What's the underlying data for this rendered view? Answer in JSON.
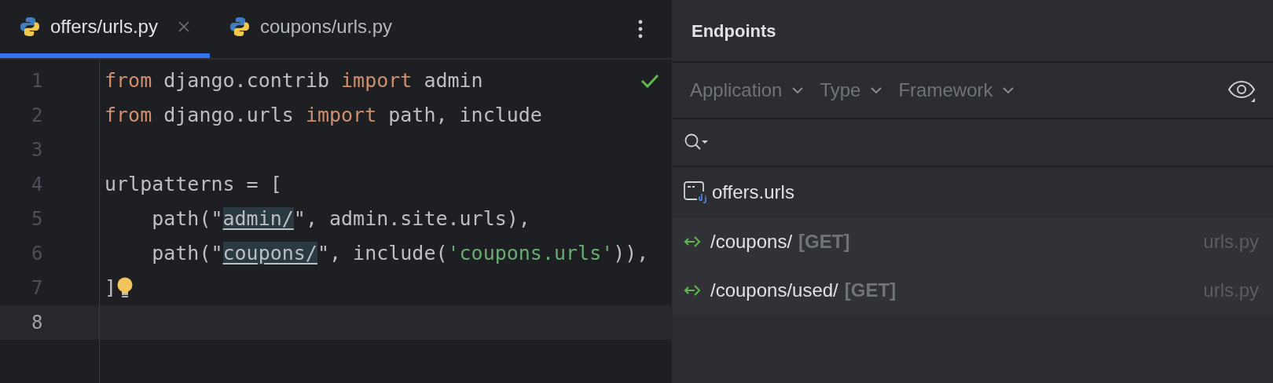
{
  "tabs": [
    {
      "label": "offers/urls.py",
      "selected": true
    },
    {
      "label": "coupons/urls.py",
      "selected": false
    }
  ],
  "editor": {
    "lines": [
      {
        "number": "1",
        "current": false,
        "tokens": [
          {
            "text": "from",
            "kind": "keyword"
          },
          {
            "text": " django.contrib ",
            "kind": "plain"
          },
          {
            "text": "import",
            "kind": "keyword"
          },
          {
            "text": " admin",
            "kind": "plain"
          }
        ]
      },
      {
        "number": "2",
        "current": false,
        "tokens": [
          {
            "text": "from",
            "kind": "keyword"
          },
          {
            "text": " django.urls ",
            "kind": "plain"
          },
          {
            "text": "import",
            "kind": "keyword"
          },
          {
            "text": " path, include",
            "kind": "plain"
          }
        ]
      },
      {
        "number": "3",
        "current": false
      },
      {
        "number": "4",
        "current": false,
        "tokens": [
          {
            "text": "urlpatterns = [",
            "kind": "plain"
          }
        ]
      },
      {
        "number": "5",
        "current": false,
        "tokens": [
          {
            "text": "    path(\"",
            "kind": "plain"
          },
          {
            "text": "admin/",
            "kind": "url"
          },
          {
            "text": "\", admin.site.urls),",
            "kind": "plain"
          }
        ]
      },
      {
        "number": "6",
        "current": false,
        "tokens": [
          {
            "text": "    path(\"",
            "kind": "plain"
          },
          {
            "text": "coupons/",
            "kind": "url"
          },
          {
            "text": "\", include(",
            "kind": "plain"
          },
          {
            "text": "'coupons.urls'",
            "kind": "string"
          },
          {
            "text": ")),",
            "kind": "plain"
          }
        ]
      },
      {
        "number": "7",
        "current": false,
        "tokens": [
          {
            "text": "]",
            "kind": "plain"
          }
        ]
      },
      {
        "number": "8",
        "current": true
      }
    ]
  },
  "endpoints": {
    "title": "Endpoints",
    "filters": [
      "Application",
      "Type",
      "Framework"
    ],
    "groups": [
      {
        "name": "offers.urls",
        "children": [
          {
            "path": "/coupons/",
            "method": "[GET]",
            "file": "urls.py"
          },
          {
            "path": "/coupons/used/",
            "method": "[GET]",
            "file": "urls.py"
          }
        ]
      }
    ]
  }
}
